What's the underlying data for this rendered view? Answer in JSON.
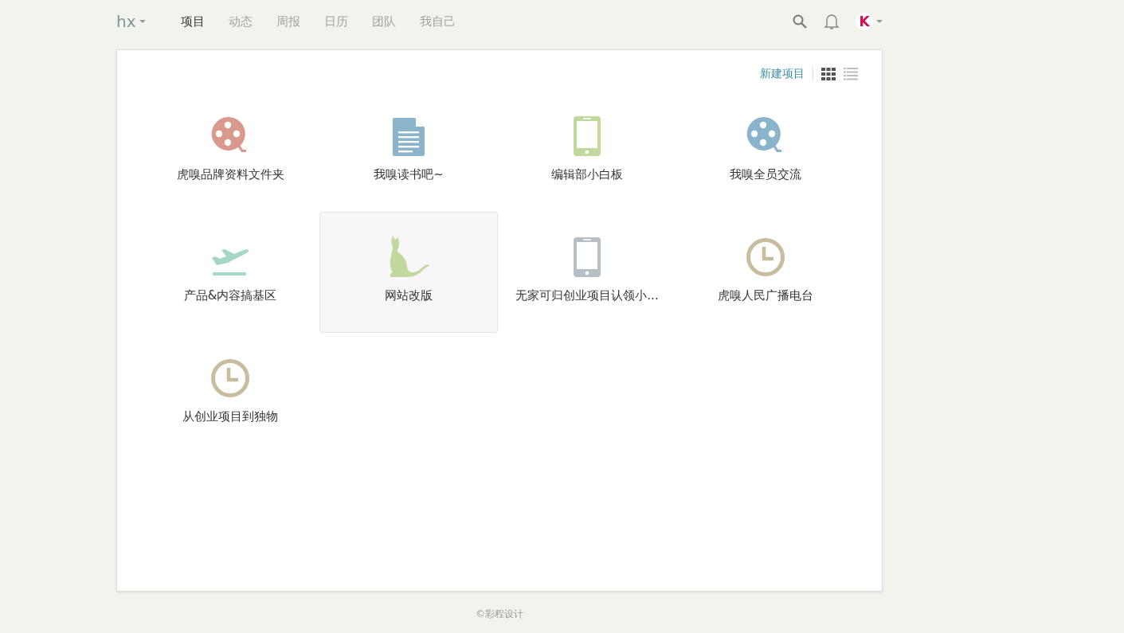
{
  "team": {
    "name": "hx"
  },
  "nav": [
    {
      "label": "项目",
      "selected": true
    },
    {
      "label": "动态",
      "selected": false
    },
    {
      "label": "周报",
      "selected": false
    },
    {
      "label": "日历",
      "selected": false
    },
    {
      "label": "团队",
      "selected": false
    },
    {
      "label": "我自己",
      "selected": false
    }
  ],
  "user": {
    "avatar_letter": "K"
  },
  "toolbar": {
    "new_project": "新建项目",
    "views": [
      {
        "kind": "grid",
        "selected": true
      },
      {
        "kind": "list",
        "selected": false
      }
    ]
  },
  "projects": [
    {
      "name": "虎嗅品牌资料文件夹",
      "kind": "film",
      "color": "#d9998d",
      "selected": false
    },
    {
      "name": "我嗅读书吧~",
      "kind": "document",
      "color": "#8ab4cb",
      "selected": false
    },
    {
      "name": "编辑部小白板",
      "kind": "phone",
      "color": "#c3d89e",
      "selected": false
    },
    {
      "name": "我嗅全员交流",
      "kind": "film",
      "color": "#8ab4cb",
      "selected": false
    },
    {
      "name": "产品&内容搞基区",
      "kind": "plane",
      "color": "#a6d6c4",
      "selected": false
    },
    {
      "name": "网站改版",
      "kind": "cat",
      "color": "#c3d89e",
      "selected": true
    },
    {
      "name": "无家可归创业项目认领小...",
      "kind": "phone",
      "color": "#b6bec6",
      "selected": false
    },
    {
      "name": "虎嗅人民广播电台",
      "kind": "clock",
      "color": "#c8bd9e",
      "selected": false
    },
    {
      "name": "从创业项目到独物",
      "kind": "clock",
      "color": "#c8bd9e",
      "selected": false
    }
  ],
  "footer": "©彩程设计"
}
